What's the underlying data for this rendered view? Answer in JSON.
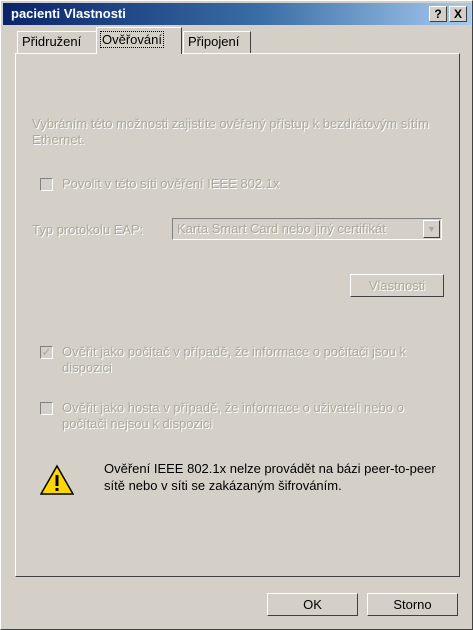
{
  "window": {
    "title": "pacienti Vlastnosti",
    "help_button": "?",
    "close_button": "X"
  },
  "tabs": [
    {
      "label": "Přidružení",
      "active": false
    },
    {
      "label": "Ověřování",
      "active": true
    },
    {
      "label": "Připojení",
      "active": false
    }
  ],
  "panel": {
    "description": "Vybráním této možnosti zajistíte ověřený přístup k bezdrátovým sítím Ethernet.",
    "enable_8021x": {
      "label": "Povolit v této síti ověření IEEE 802.1x",
      "checked": false
    },
    "eap_type_label": "Typ protokolu EAP:",
    "eap_type_value": "Karta Smart Card nebo jiný certifikát",
    "properties_button": "Vlastnosti",
    "auth_as_computer": {
      "label": "Ověřit jako počítač v případě, že informace o počítači jsou k dispozici",
      "checked": true
    },
    "auth_as_guest": {
      "label": "Ověřit jako hosta v případě, že informace o uživateli nebo o počítači nejsou k dispozici",
      "checked": false
    },
    "warning_text": "Ověření IEEE 802.1x nelze provádět na bázi peer-to-peer sítě nebo v síti se zakázaným šifrováním."
  },
  "footer": {
    "ok_button": "OK",
    "cancel_button": "Storno"
  }
}
